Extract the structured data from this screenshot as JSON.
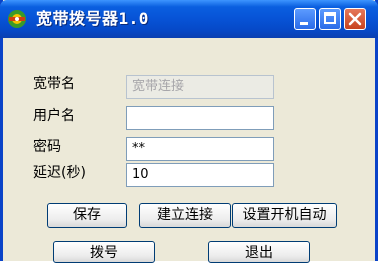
{
  "window": {
    "title": "宽带拨号器1.0",
    "icon": "dial-up-app-icon",
    "controls": {
      "minimize": "minimize-icon",
      "maximize": "maximize-icon",
      "close": "close-icon"
    }
  },
  "form": {
    "broadband_name": {
      "label": "宽带名",
      "value": "宽带连接",
      "disabled": true
    },
    "username": {
      "label": "用户名",
      "value": ""
    },
    "password": {
      "label": "密码",
      "value": "**"
    },
    "delay": {
      "label": "延迟(秒)",
      "value": "10"
    }
  },
  "buttons": {
    "save": "保存",
    "create_connection": "建立连接",
    "autostart": "设置开机自动",
    "dial": "拨号",
    "exit": "退出"
  },
  "colors": {
    "titlebar": "#0753d6",
    "window_bg": "#ece9d8",
    "close_button": "#c8421f"
  }
}
